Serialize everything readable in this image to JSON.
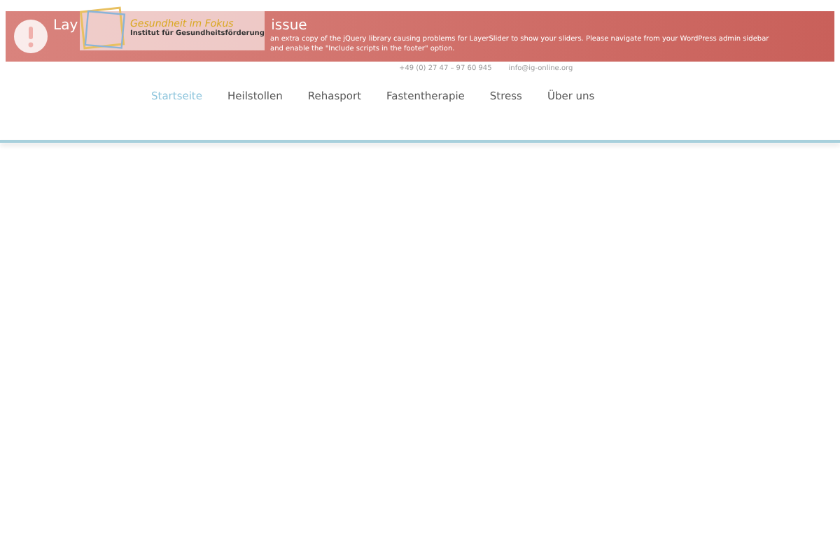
{
  "notice": {
    "heading_start": "Lay",
    "heading_end": "issue",
    "line_1": "an extra copy of the jQuery library causing problems for LayerSlider to show your sliders. Please navigate from your WordPress admin sidebar",
    "line_2": "and enable the \"Include scripts in the footer\" option."
  },
  "logo": {
    "title": "Gesundheit im Fokus",
    "subtitle": "Institut für Gesundheitsförderung"
  },
  "contact": {
    "phone": "+49 (0) 27 47 – 97 60 945",
    "email": "info@ig-online.org"
  },
  "nav": [
    {
      "label": "Startseite",
      "selected": true
    },
    {
      "label": "Heilstollen",
      "selected": false
    },
    {
      "label": "Rehasport",
      "selected": false
    },
    {
      "label": "Fastentherapie",
      "selected": false
    },
    {
      "label": "Stress",
      "selected": false
    },
    {
      "label": "Über uns",
      "selected": false
    }
  ]
}
